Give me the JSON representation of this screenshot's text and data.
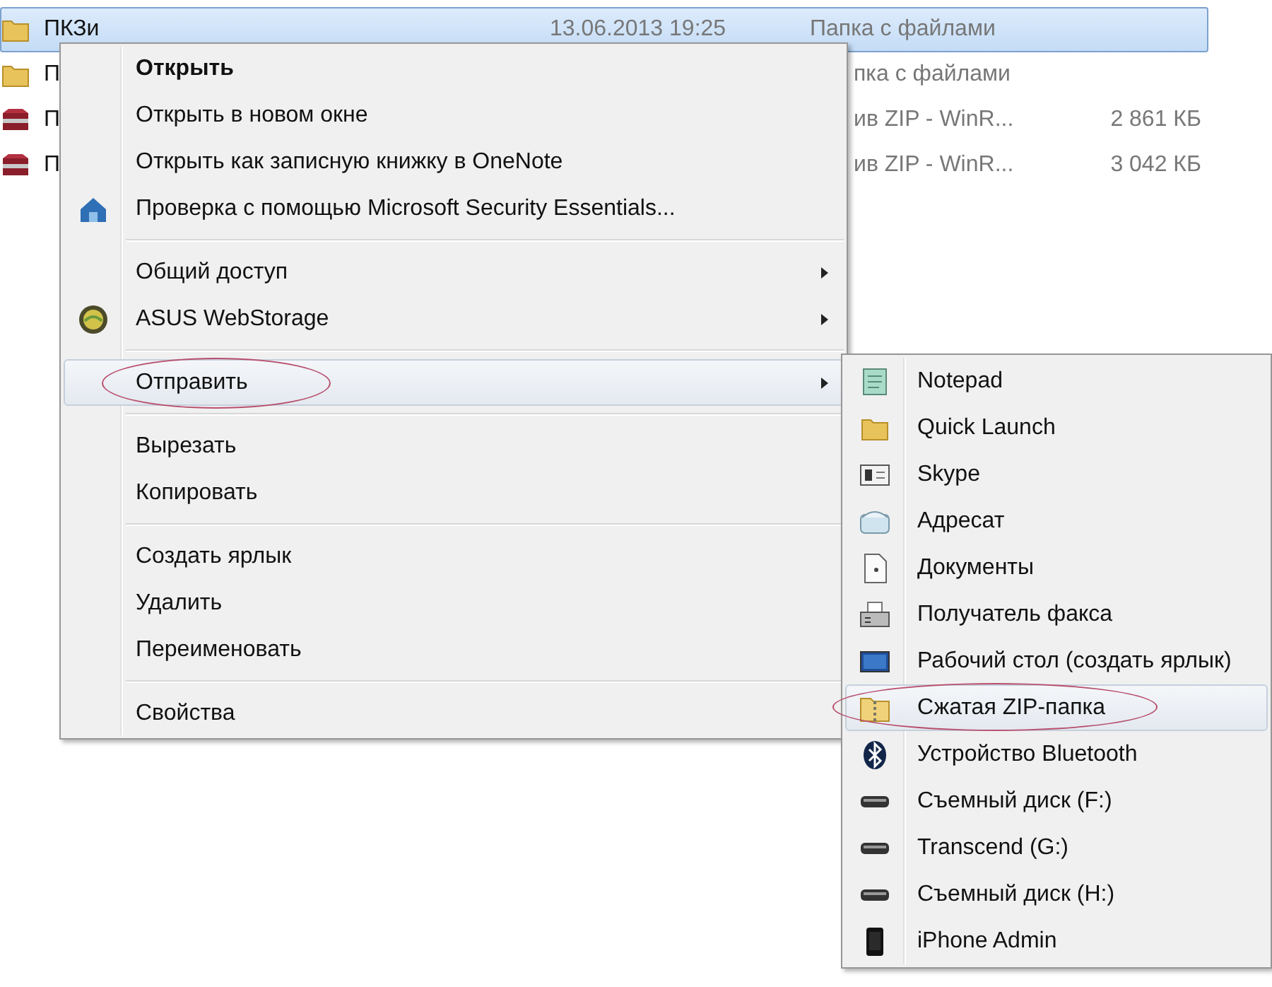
{
  "files": [
    {
      "kind": "folder",
      "name": "ПКЗи",
      "date": "13.06.2013 19:25",
      "type": "Папка с файлами",
      "selected": true
    },
    {
      "kind": "folder",
      "name": "П",
      "type_fragment": "пка с файлами",
      "selected": false
    },
    {
      "kind": "archive",
      "name": "П",
      "type_fragment": "ив ZIP - WinR...",
      "size": "2 861 КБ",
      "selected": false
    },
    {
      "kind": "archive",
      "name": "П",
      "type_fragment": "ив ZIP - WinR...",
      "size": "3 042 КБ",
      "selected": false
    }
  ],
  "context_menu": {
    "items": [
      {
        "kind": "item",
        "label": "Открыть",
        "default": true,
        "submenu": false,
        "selected": false,
        "circled": false
      },
      {
        "kind": "item",
        "label": "Открыть в новом окне",
        "default": false,
        "submenu": false,
        "selected": false,
        "circled": false
      },
      {
        "kind": "item",
        "label": "Открыть как записную книжку в OneNote",
        "default": false,
        "submenu": false,
        "selected": false,
        "circled": false
      },
      {
        "kind": "item",
        "label": "Проверка с помощью Microsoft Security Essentials...",
        "default": false,
        "submenu": false,
        "selected": false,
        "circled": false
      },
      {
        "kind": "separator"
      },
      {
        "kind": "item",
        "label": "Общий доступ",
        "default": false,
        "submenu": true,
        "selected": false,
        "circled": false
      },
      {
        "kind": "item",
        "label": "ASUS WebStorage",
        "default": false,
        "submenu": true,
        "selected": false,
        "circled": false
      },
      {
        "kind": "separator"
      },
      {
        "kind": "item",
        "label": "Отправить",
        "default": false,
        "submenu": true,
        "selected": true,
        "circled": true
      },
      {
        "kind": "separator"
      },
      {
        "kind": "item",
        "label": "Вырезать",
        "default": false,
        "submenu": false,
        "selected": false,
        "circled": false
      },
      {
        "kind": "item",
        "label": "Копировать",
        "default": false,
        "submenu": false,
        "selected": false,
        "circled": false
      },
      {
        "kind": "separator"
      },
      {
        "kind": "item",
        "label": "Создать ярлык",
        "default": false,
        "submenu": false,
        "selected": false,
        "circled": false
      },
      {
        "kind": "item",
        "label": "Удалить",
        "default": false,
        "submenu": false,
        "selected": false,
        "circled": false
      },
      {
        "kind": "item",
        "label": "Переименовать",
        "default": false,
        "submenu": false,
        "selected": false,
        "circled": false
      },
      {
        "kind": "separator"
      },
      {
        "kind": "item",
        "label": "Свойства",
        "default": false,
        "submenu": false,
        "selected": false,
        "circled": false
      }
    ]
  },
  "send_to_menu": {
    "items": [
      {
        "label": "Notepad",
        "selected": false,
        "circled": false
      },
      {
        "label": "Quick Launch",
        "selected": false,
        "circled": false
      },
      {
        "label": "Skype",
        "selected": false,
        "circled": false
      },
      {
        "label": "Адресат",
        "selected": false,
        "circled": false
      },
      {
        "label": "Документы",
        "selected": false,
        "circled": false
      },
      {
        "label": "Получатель факса",
        "selected": false,
        "circled": false
      },
      {
        "label": "Рабочий стол (создать ярлык)",
        "selected": false,
        "circled": false
      },
      {
        "label": "Сжатая ZIP-папка",
        "selected": true,
        "circled": true
      },
      {
        "label": "Устройство Bluetooth",
        "selected": false,
        "circled": false
      },
      {
        "label": "Съемный диск (F:)",
        "selected": false,
        "circled": false
      },
      {
        "label": "Transcend (G:)",
        "selected": false,
        "circled": false
      },
      {
        "label": "Съемный диск (H:)",
        "selected": false,
        "circled": false
      },
      {
        "label": "iPhone Admin",
        "selected": false,
        "circled": false
      }
    ]
  }
}
